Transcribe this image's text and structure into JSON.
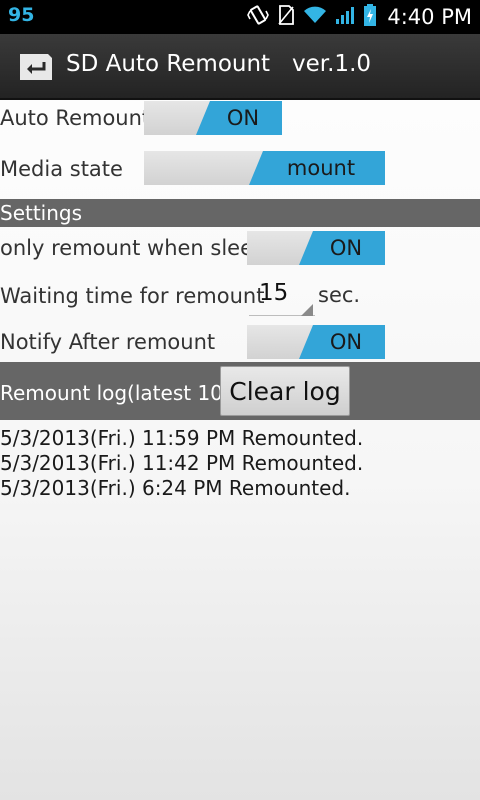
{
  "status_bar": {
    "battery_percent": "95",
    "time": "4:40 PM",
    "icons": [
      "vibrate-icon",
      "no-sim-icon",
      "wifi-icon",
      "signal-icon",
      "battery-charging-icon"
    ]
  },
  "action_bar": {
    "title": "SD Auto Remount   ver.1.0",
    "icon": "back-card-icon"
  },
  "auto_remount": {
    "label": "Auto Remount",
    "value": "ON"
  },
  "media_state": {
    "label": "Media state",
    "value": "mount"
  },
  "settings": {
    "header": "Settings",
    "sleep_only": {
      "label": "only remount when sleep",
      "value": "ON"
    },
    "waiting_time": {
      "label": "Waiting time for remount",
      "value": "15",
      "unit": "sec."
    },
    "notify": {
      "label": "Notify After remount",
      "value": "ON"
    }
  },
  "log": {
    "header": "Remount log(latest 10)",
    "clear_label": "Clear log",
    "entries": [
      "5/3/2013(Fri.) 11:59 PM Remounted.",
      "5/3/2013(Fri.) 11:42 PM Remounted.",
      "5/3/2013(Fri.) 6:24 PM Remounted."
    ]
  },
  "colors": {
    "accent": "#33a5d8",
    "status_accent": "#33b5e5",
    "section_bg": "#666666",
    "actionbar_bg": "#2a2a2a"
  }
}
